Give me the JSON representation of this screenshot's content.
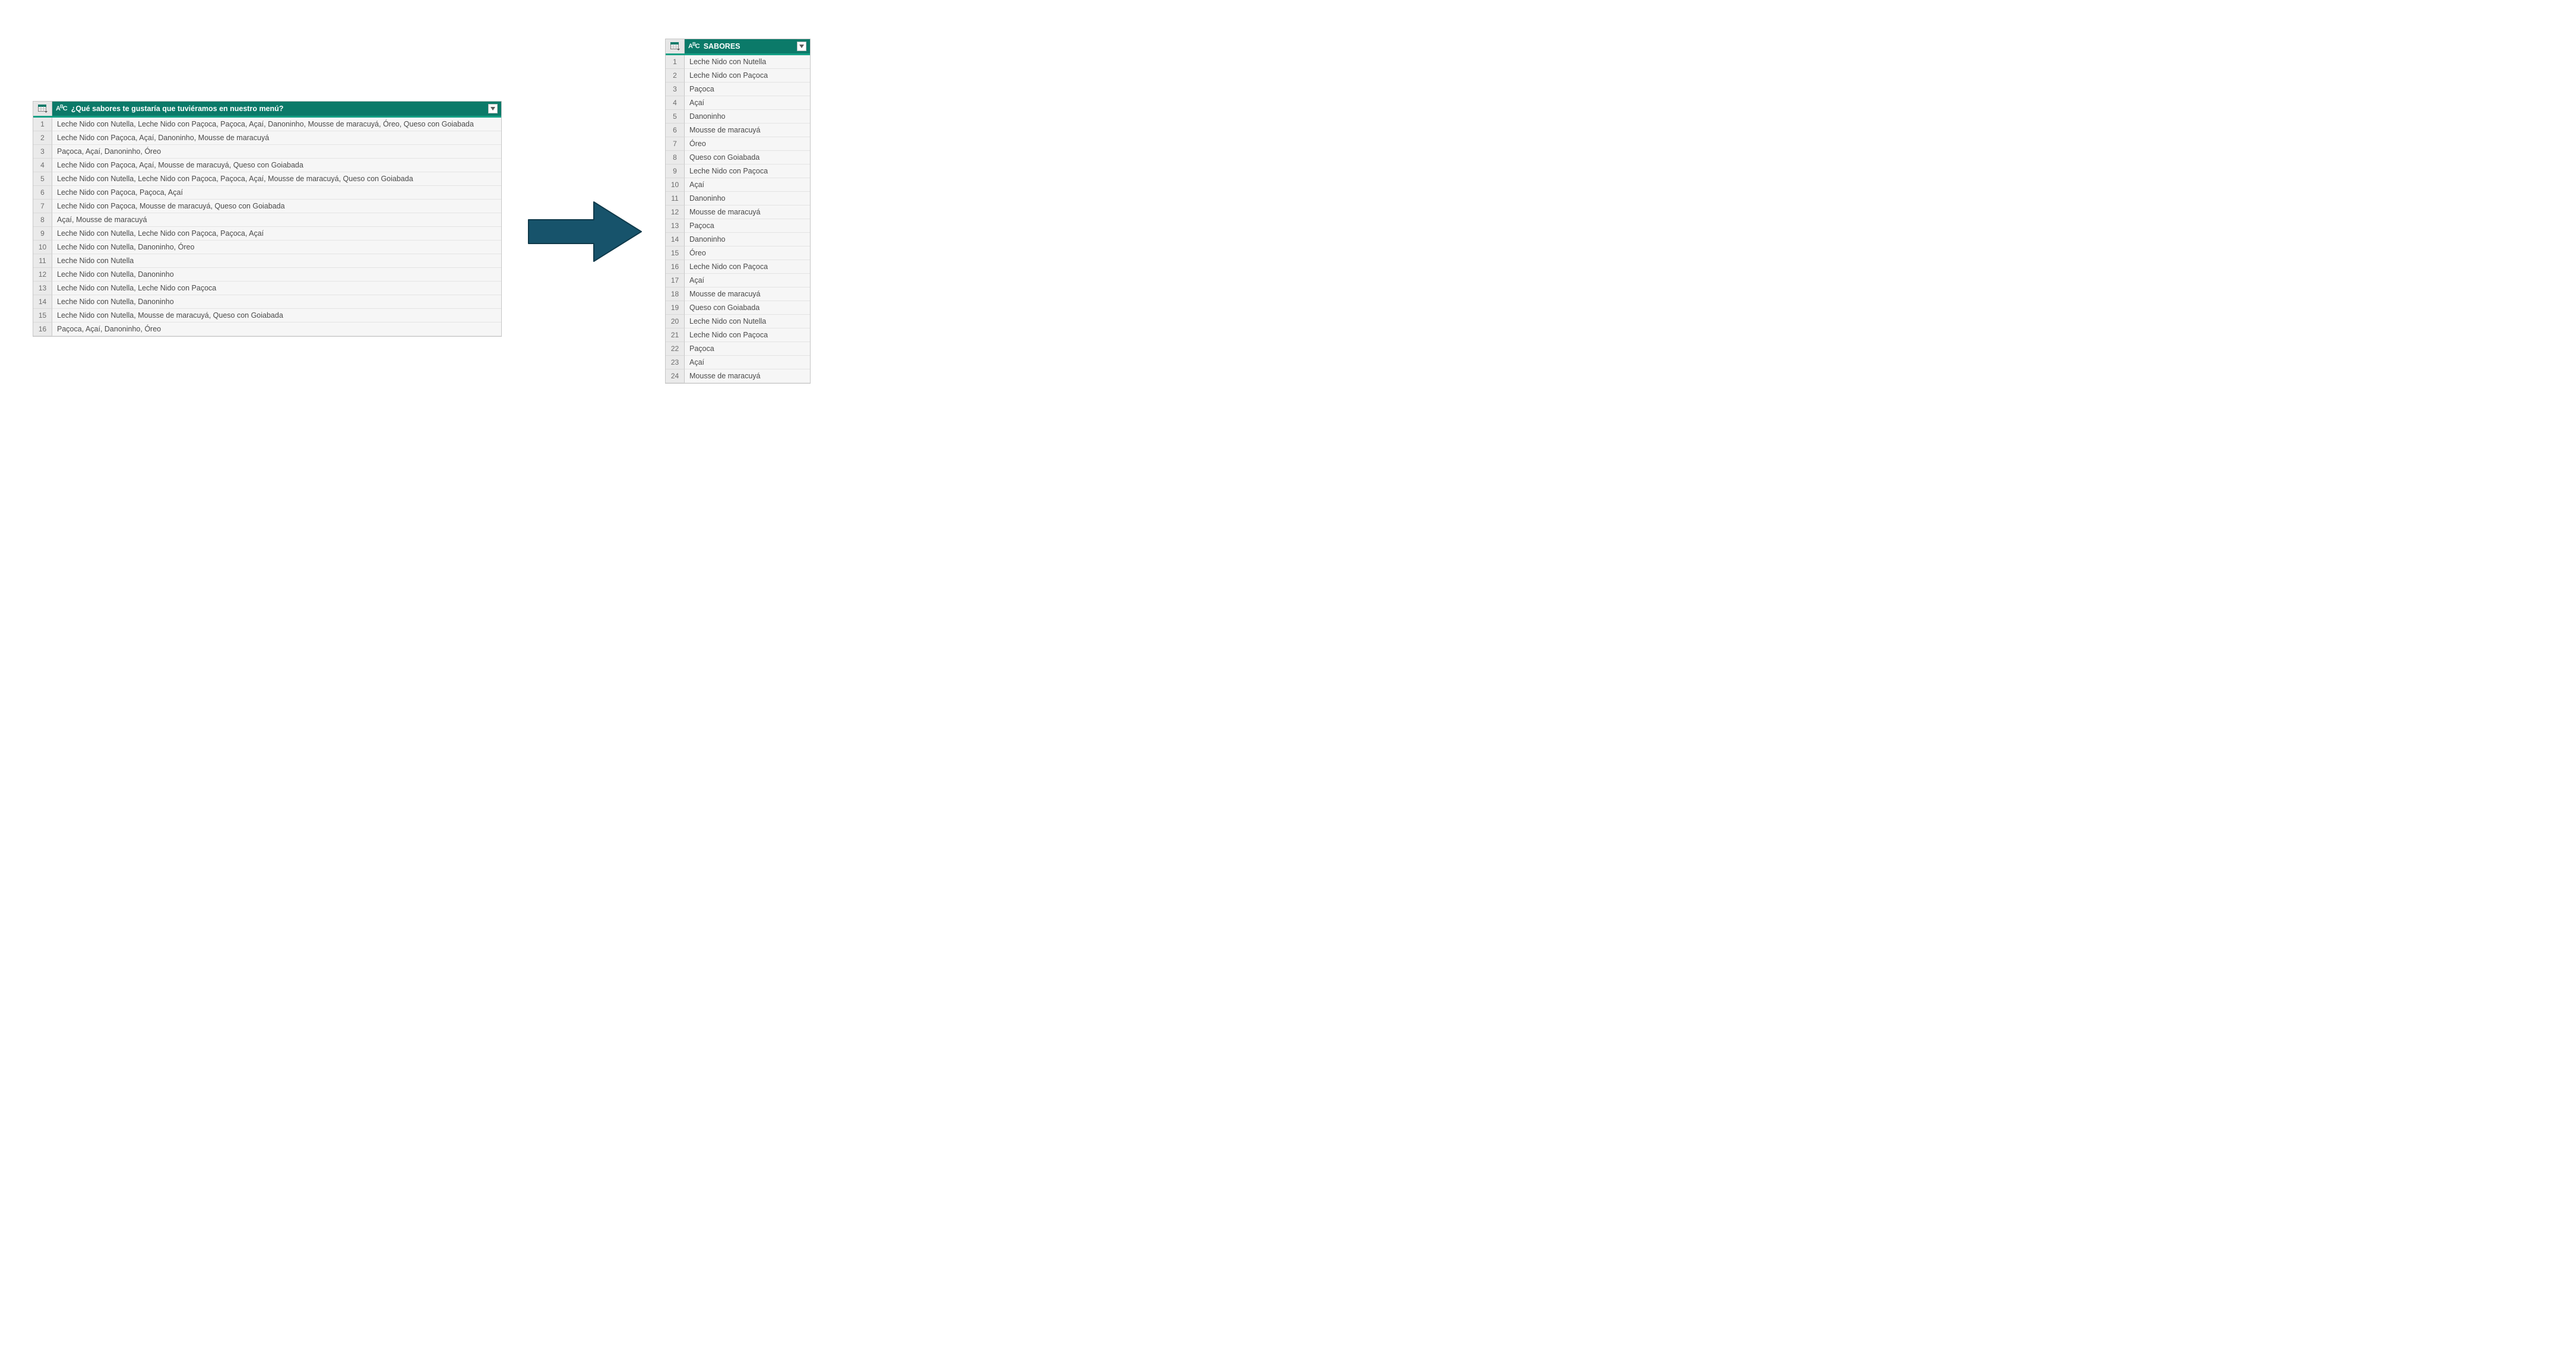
{
  "colors": {
    "header_bg": "#0b7a69",
    "header_accent": "#14a085",
    "arrow_fill": "#17536b",
    "arrow_stroke": "#0f3a4b"
  },
  "left_table": {
    "column_type_label": "ABC",
    "column_header": "¿Qué sabores te gustaría que tuviéramos en nuestro menú?",
    "rows": [
      "Leche Nido con Nutella, Leche Nido con Paçoca, Paçoca, Açaí, Danoninho, Mousse de maracuyá, Óreo, Queso con Goiabada",
      "Leche Nido con Paçoca, Açaí, Danoninho, Mousse de maracuyá",
      "Paçoca, Açaí, Danoninho, Óreo",
      "Leche Nido con Paçoca, Açaí, Mousse de maracuyá, Queso con Goiabada",
      "Leche Nido con Nutella, Leche Nido con Paçoca, Paçoca, Açaí, Mousse de maracuyá, Queso con Goiabada",
      "Leche Nido con Paçoca, Paçoca, Açaí",
      "Leche Nido con Paçoca, Mousse de maracuyá, Queso con Goiabada",
      "Açaí, Mousse de maracuyá",
      "Leche Nido con Nutella, Leche Nido con Paçoca, Paçoca, Açaí",
      "Leche Nido con Nutella, Danoninho, Óreo",
      "Leche Nido con Nutella",
      "Leche Nido con Nutella, Danoninho",
      "Leche Nido con Nutella, Leche Nido con Paçoca",
      "Leche Nido con Nutella, Danoninho",
      "Leche Nido con Nutella, Mousse de maracuyá, Queso con Goiabada",
      "Paçoca, Açaí, Danoninho, Óreo"
    ]
  },
  "right_table": {
    "column_type_label": "ABC",
    "column_header": "SABORES",
    "rows": [
      "Leche Nido con Nutella",
      "Leche Nido con Paçoca",
      "Paçoca",
      "Açaí",
      "Danoninho",
      "Mousse de maracuyá",
      "Óreo",
      "Queso con Goiabada",
      "Leche Nido con Paçoca",
      "Açaí",
      "Danoninho",
      "Mousse de maracuyá",
      "Paçoca",
      "Danoninho",
      "Óreo",
      "Leche Nido con Paçoca",
      "Açaí",
      "Mousse de maracuyá",
      "Queso con Goiabada",
      "Leche Nido con Nutella",
      "Leche Nido con Paçoca",
      "Paçoca",
      "Açaí",
      "Mousse de maracuyá"
    ]
  }
}
